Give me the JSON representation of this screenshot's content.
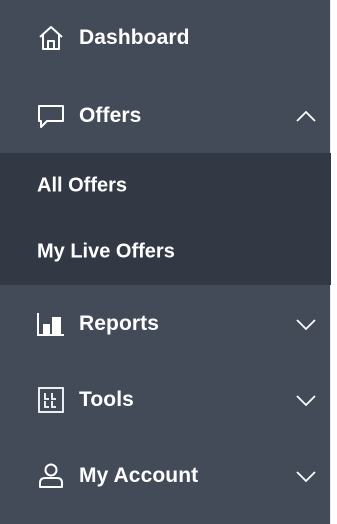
{
  "sidebar": {
    "items": [
      {
        "label": "Dashboard",
        "icon": "home-icon",
        "expandable": false
      },
      {
        "label": "Offers",
        "icon": "speech-bubble-icon",
        "expandable": true,
        "expanded": true,
        "children": [
          {
            "label": "All Offers"
          },
          {
            "label": "My Live Offers"
          }
        ]
      },
      {
        "label": "Reports",
        "icon": "bar-chart-icon",
        "expandable": true,
        "expanded": false
      },
      {
        "label": "Tools",
        "icon": "tools-grid-icon",
        "expandable": true,
        "expanded": false
      },
      {
        "label": "My Account",
        "icon": "user-icon",
        "expandable": true,
        "expanded": false
      }
    ]
  },
  "colors": {
    "sidebar_bg": "#434a58",
    "submenu_bg": "#333944",
    "text": "#ffffff"
  }
}
